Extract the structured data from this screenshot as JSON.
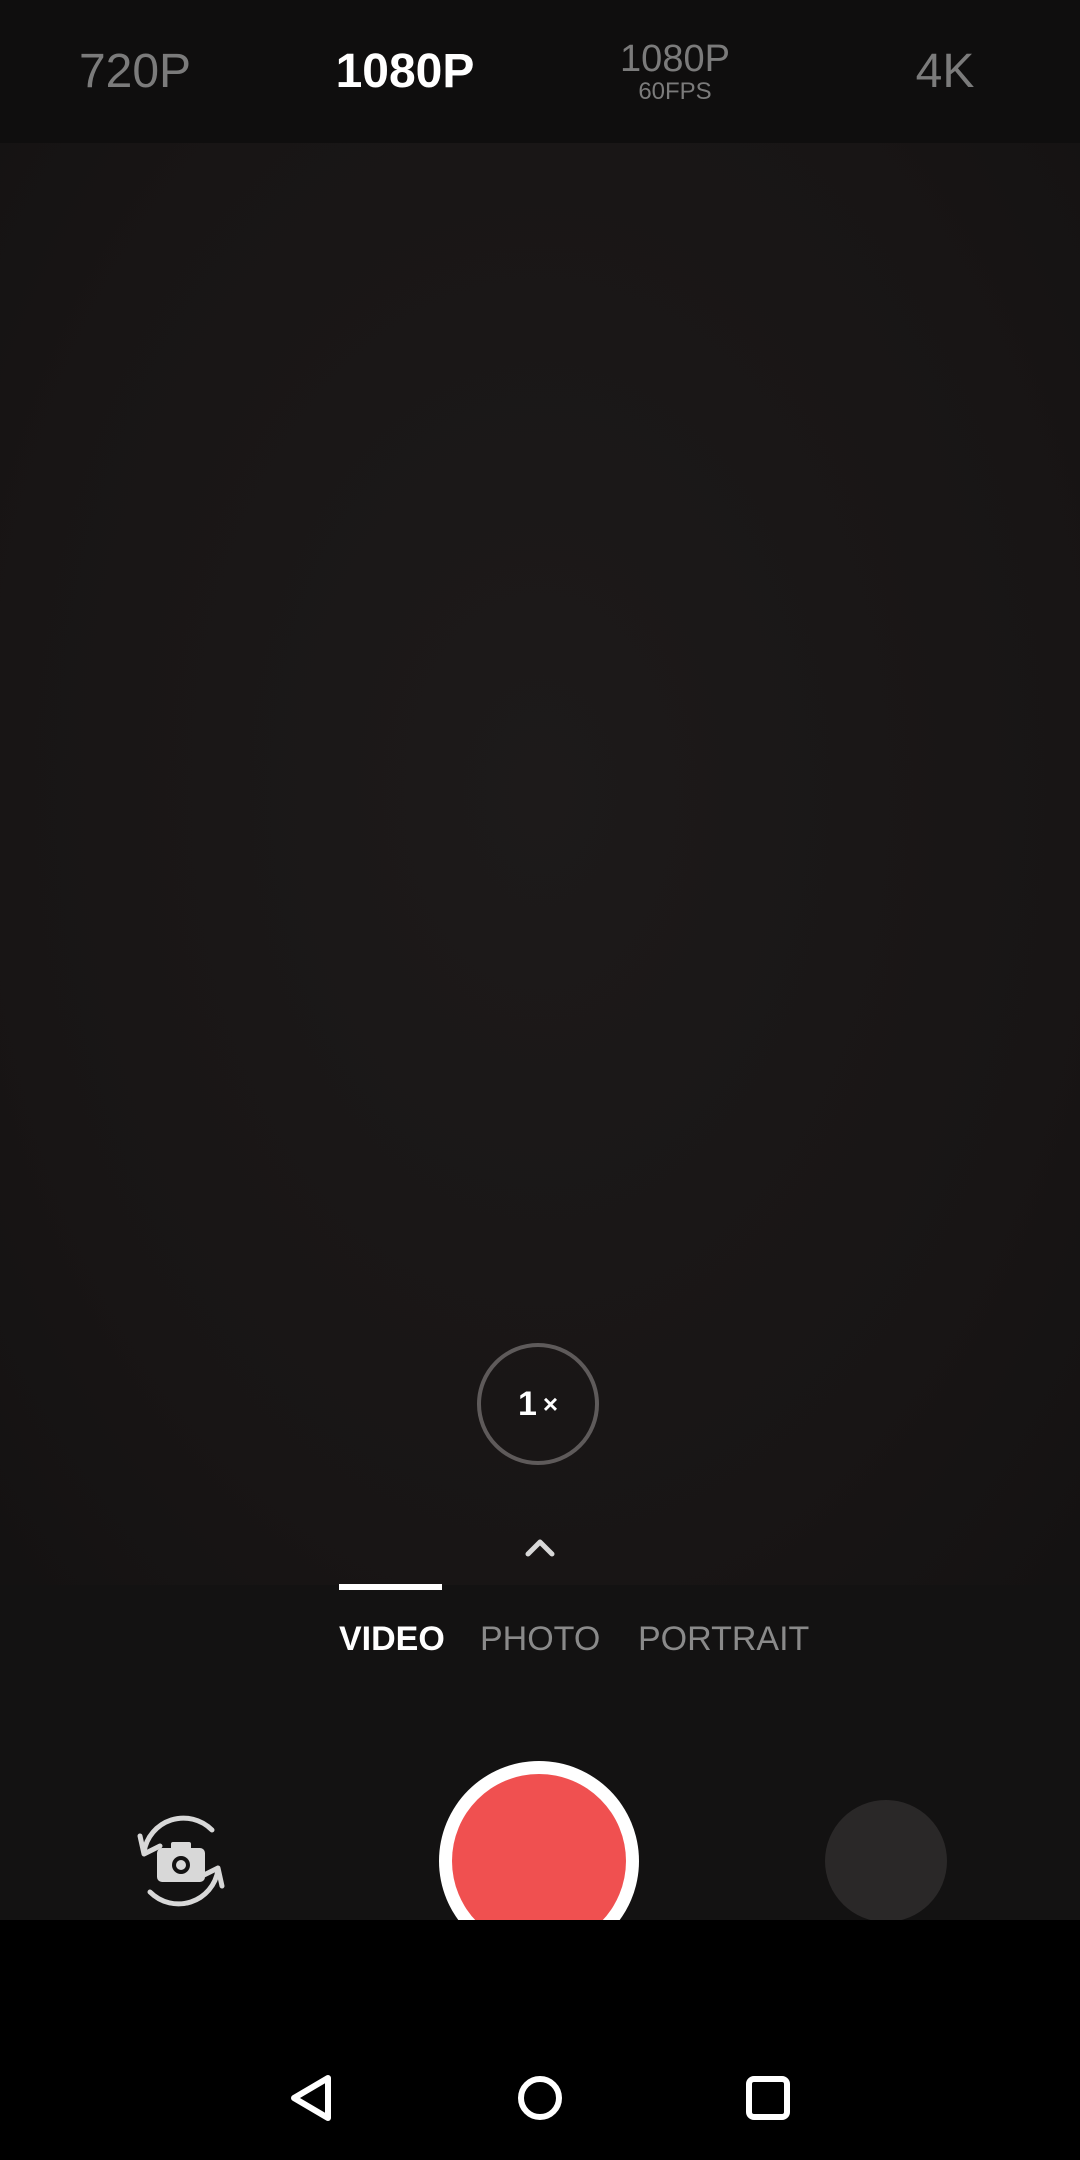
{
  "resolutions": [
    {
      "label": "720P",
      "sub": ""
    },
    {
      "label": "1080P",
      "sub": ""
    },
    {
      "label": "1080P",
      "sub": "60FPS"
    },
    {
      "label": "4K",
      "sub": ""
    }
  ],
  "selected_resolution": "1080P",
  "zoom": {
    "value": "1",
    "suffix": "×"
  },
  "modes": [
    {
      "label": "VIDEO"
    },
    {
      "label": "PHOTO"
    },
    {
      "label": "PORTRAIT"
    }
  ],
  "selected_mode": "VIDEO",
  "colors": {
    "shutter": "#f05050",
    "accent": "#ffffff",
    "inactive": "#7b7b7b"
  },
  "icons": {
    "flip": "camera-flip-icon",
    "expand": "chevron-up-icon",
    "back": "back-icon",
    "home": "home-icon",
    "recents": "recents-icon"
  }
}
